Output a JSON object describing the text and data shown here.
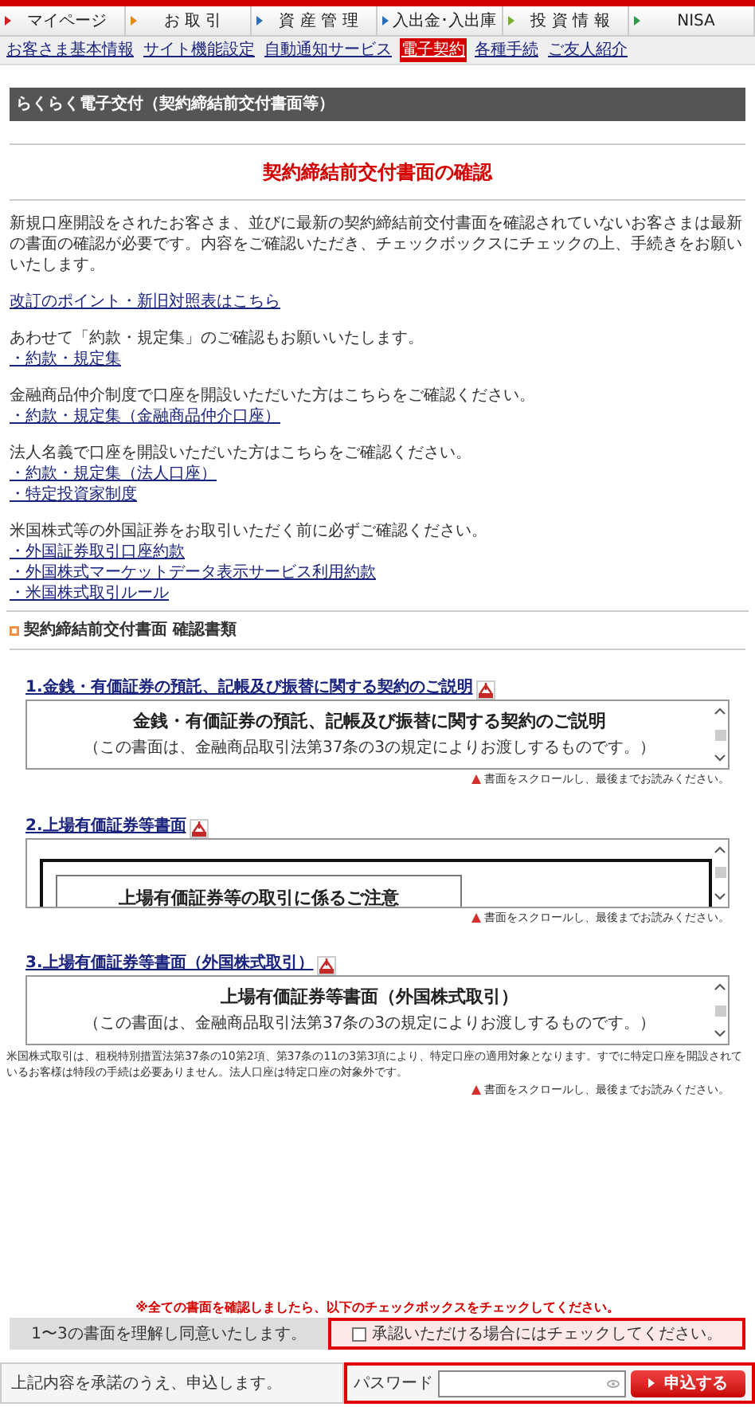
{
  "nav_tabs": [
    {
      "label": "マイページ",
      "color": "#cc2222"
    },
    {
      "label": "お 取 引",
      "color": "#e08a1e"
    },
    {
      "label": "資 産 管 理",
      "color": "#2a6fb8"
    },
    {
      "label": "入出金･入出庫",
      "color": "#2a6fb8"
    },
    {
      "label": "投 資 情 報",
      "color": "#7cae2a"
    },
    {
      "label": "NISA",
      "color": "#2f9a4a"
    }
  ],
  "sub_nav": [
    {
      "label": "お客さま基本情報",
      "selected": false
    },
    {
      "label": "サイト機能設定",
      "selected": false
    },
    {
      "label": "自動通知サービス",
      "selected": false
    },
    {
      "label": "電子契約",
      "selected": true
    },
    {
      "label": "各種手続",
      "selected": false
    },
    {
      "label": "ご友人紹介",
      "selected": false
    }
  ],
  "page_header": "らくらく電子交付（契約締結前交付書面等）",
  "title": "契約締結前交付書面の確認",
  "intro": "新規口座開設をされたお客さま、並びに最新の契約締結前交付書面を確認されていないお客さまは最新の書面の確認が必要です。内容をご確認いただき、チェックボックスにチェックの上、手続きをお願いいたします。",
  "groups": [
    {
      "links": [
        "改訂のポイント・新旧対照表はこちら"
      ]
    },
    {
      "text": "あわせて「約款・規定集」のご確認もお願いいたします。",
      "links": [
        "・約款・規定集"
      ]
    },
    {
      "text": "金融商品仲介制度で口座を開設いただいた方はこちらをご確認ください。",
      "links": [
        "・約款・規定集（金融商品仲介口座）"
      ]
    },
    {
      "text": "法人名義で口座を開設いただいた方はこちらをご確認ください。",
      "links": [
        "・約款・規定集（法人口座）",
        "・特定投資家制度"
      ]
    },
    {
      "text": "米国株式等の外国証券をお取引いただく前に必ずご確認ください。",
      "links": [
        "・外国証券取引口座約款",
        "・外国株式マーケットデータ表示サービス利用約款",
        "・米国株式取引ルール"
      ]
    }
  ],
  "section_title": "契約締結前交付書面 確認書類",
  "documents": [
    {
      "kind": "plain",
      "link": "1.金銭・有価証券の預託、記帳及び振替に関する契約のご説明",
      "heading": "金銭・有価証券の預託、記帳及び振替に関する契約のご説明",
      "subheading": "（この書面は、金融商品取引法第37条の3の規定によりお渡しするものです。）",
      "warning": "書面をスクロールし、最後までお読みください。"
    },
    {
      "kind": "framed",
      "link": "2.上場有価証券等書面",
      "heading": "上場有価証券等の取引に係るご注意",
      "warning": "書面をスクロールし、最後までお読みください。"
    },
    {
      "kind": "plain",
      "link": "3.上場有価証券等書面（外国株式取引）",
      "heading": "上場有価証券等書面（外国株式取引）",
      "subheading": "（この書面は、金融商品取引法第37条の3の規定によりお渡しするものです。）",
      "note": "米国株式取引は、租税特別措置法第37条の10第2項、第37条の11の3第3項により、特定口座の適用対象となります。すでに特定口座を開設されているお客様は特段の手続は必要ありません。法人口座は特定口座の対象外です。",
      "warning": "書面をスクロールし、最後までお読みください。"
    }
  ],
  "confirm_notice": "※全ての書面を確認しましたら、以下のチェックボックスをチェックしてください。",
  "agree_label": "1〜3の書面を理解し同意いたします。",
  "agree_checkbox": {
    "label": "承認いただける場合にはチェックしてください。",
    "checked": false
  },
  "submit_row": {
    "text": "上記内容を承諾のうえ、申込します。",
    "password_label": "パスワード",
    "button": "申込する"
  }
}
